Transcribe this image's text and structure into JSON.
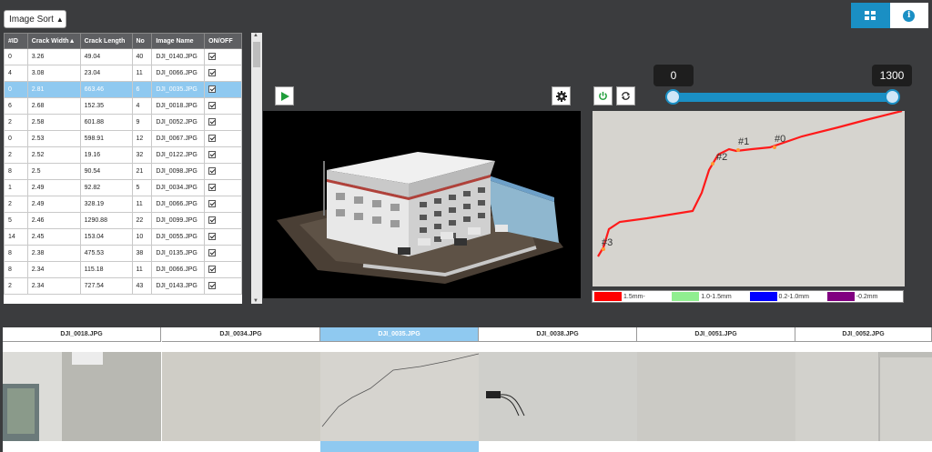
{
  "sort": {
    "label": "Image Sort"
  },
  "table": {
    "headers": [
      "#ID",
      "Crack Width",
      "Crack Length",
      "No",
      "Image Name",
      "ON/OFF"
    ],
    "rows": [
      [
        "0",
        "3.26",
        "49.04",
        "40",
        "DJI_0140.JPG"
      ],
      [
        "4",
        "3.08",
        "23.04",
        "11",
        "DJI_0066.JPG"
      ],
      [
        "0",
        "2.81",
        "663.46",
        "6",
        "DJI_0035.JPG"
      ],
      [
        "6",
        "2.68",
        "152.35",
        "4",
        "DJI_0018.JPG"
      ],
      [
        "2",
        "2.58",
        "601.88",
        "9",
        "DJI_0052.JPG"
      ],
      [
        "0",
        "2.53",
        "598.91",
        "12",
        "DJI_0067.JPG"
      ],
      [
        "2",
        "2.52",
        "19.16",
        "32",
        "DJI_0122.JPG"
      ],
      [
        "8",
        "2.5",
        "90.54",
        "21",
        "DJI_0098.JPG"
      ],
      [
        "1",
        "2.49",
        "92.82",
        "5",
        "DJI_0034.JPG"
      ],
      [
        "2",
        "2.49",
        "328.19",
        "11",
        "DJI_0066.JPG"
      ],
      [
        "5",
        "2.46",
        "1290.88",
        "22",
        "DJI_0099.JPG"
      ],
      [
        "14",
        "2.45",
        "153.04",
        "10",
        "DJI_0055.JPG"
      ],
      [
        "8",
        "2.38",
        "475.53",
        "38",
        "DJI_0135.JPG"
      ],
      [
        "8",
        "2.34",
        "115.18",
        "11",
        "DJI_0066.JPG"
      ],
      [
        "2",
        "2.34",
        "727.54",
        "43",
        "DJI_0143.JPG"
      ]
    ],
    "selected_index": 2
  },
  "slider": {
    "min_label": "0",
    "max_label": "1300"
  },
  "crack": {
    "labels": [
      "#1",
      "#0",
      "#2",
      "#3"
    ]
  },
  "legend": [
    {
      "label": "1.5mm-",
      "color": "#ff0000"
    },
    {
      "label": "1.0-1.5mm",
      "color": "#90ee90"
    },
    {
      "label": "0.2-1.0mm",
      "color": "#0000ff"
    },
    {
      "label": "-0.2mm",
      "color": "#800080"
    }
  ],
  "filmstrip": {
    "items": [
      "DJI_0018.JPG",
      "DJI_0034.JPG",
      "DJI_0035.JPG",
      "DJI_0038.JPG",
      "DJI_0051.JPG",
      "DJI_0052.JPG"
    ],
    "selected_index": 2
  },
  "colors": {
    "accent": "#1a8fc4",
    "selected_row": "#8fc9f0"
  }
}
